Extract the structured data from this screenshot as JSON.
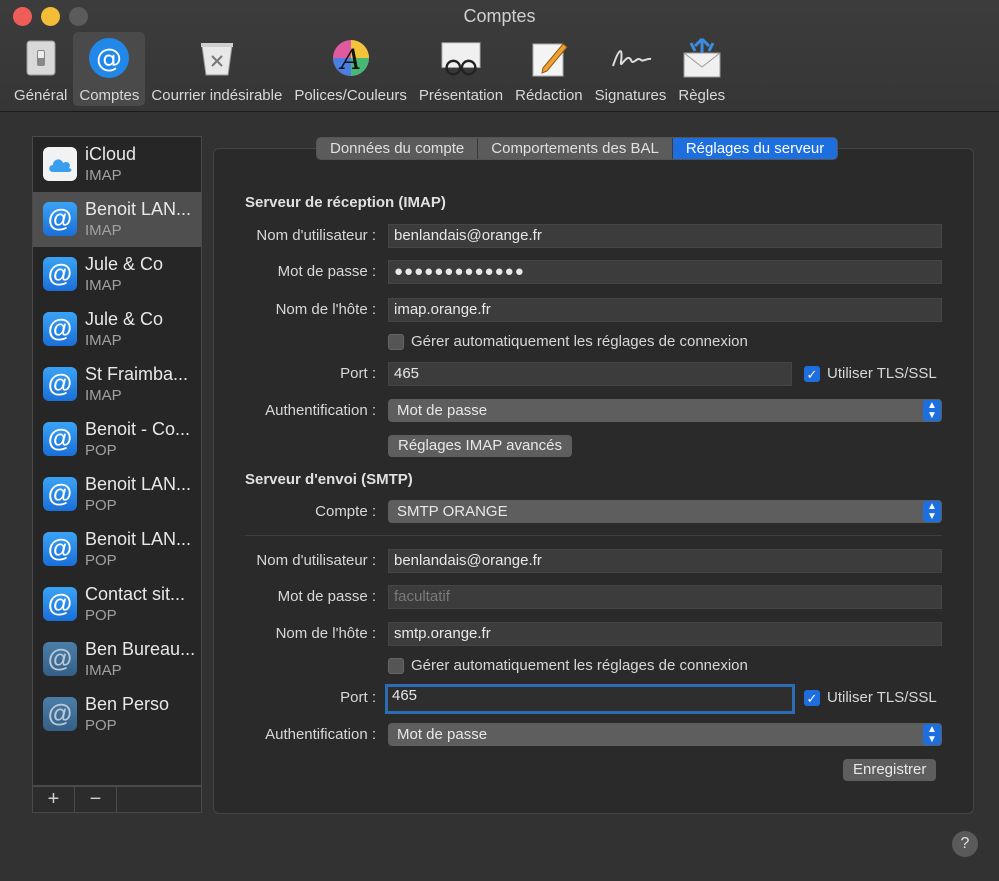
{
  "window": {
    "title": "Comptes"
  },
  "toolbar": {
    "items": [
      {
        "label": "Général",
        "icon": "general-switch-icon"
      },
      {
        "label": "Comptes",
        "icon": "at-sign-icon",
        "active": true
      },
      {
        "label": "Courrier indésirable",
        "icon": "junk-trash-icon"
      },
      {
        "label": "Polices/Couleurs",
        "icon": "fonts-colors-icon"
      },
      {
        "label": "Présentation",
        "icon": "viewing-glasses-icon"
      },
      {
        "label": "Rédaction",
        "icon": "composing-pencil-icon"
      },
      {
        "label": "Signatures",
        "icon": "signature-icon"
      },
      {
        "label": "Règles",
        "icon": "rules-envelope-icon"
      }
    ]
  },
  "accounts": [
    {
      "name": "iCloud",
      "type": "IMAP",
      "icon": "icloud-icon"
    },
    {
      "name": "Benoit LAN...",
      "type": "IMAP",
      "icon": "at-sign-icon",
      "selected": true
    },
    {
      "name": "Jule & Co",
      "type": "IMAP",
      "icon": "at-sign-icon"
    },
    {
      "name": "Jule & Co",
      "type": "IMAP",
      "icon": "at-sign-icon"
    },
    {
      "name": "St Fraimba...",
      "type": "IMAP",
      "icon": "at-sign-icon"
    },
    {
      "name": "Benoit - Co...",
      "type": "POP",
      "icon": "at-sign-icon"
    },
    {
      "name": "Benoit LAN...",
      "type": "POP",
      "icon": "at-sign-icon"
    },
    {
      "name": "Benoit LAN...",
      "type": "POP",
      "icon": "at-sign-icon"
    },
    {
      "name": "Contact sit...",
      "type": "POP",
      "icon": "at-sign-icon"
    },
    {
      "name": "Ben Bureau...",
      "type": "IMAP",
      "icon": "at-sign-icon",
      "dim": true
    },
    {
      "name": "Ben Perso",
      "type": "POP",
      "icon": "at-sign-icon",
      "dim": true
    }
  ],
  "list_footer": {
    "add": "+",
    "remove": "−"
  },
  "tabs": [
    {
      "label": "Données du compte"
    },
    {
      "label": "Comportements des BAL"
    },
    {
      "label": "Réglages du serveur",
      "active": true
    }
  ],
  "incoming": {
    "title": "Serveur de réception (IMAP)",
    "username_label": "Nom d'utilisateur :",
    "username": "benlandais@orange.fr",
    "password_label": "Mot de passe :",
    "password": "●●●●●●●●●●●●●",
    "host_label": "Nom de l'hôte :",
    "host": "imap.orange.fr",
    "auto_manage": "Gérer automatiquement les réglages de connexion",
    "port_label": "Port :",
    "port": "465",
    "tls_label": "Utiliser TLS/SSL",
    "auth_label": "Authentification :",
    "auth": "Mot de passe",
    "advanced_button": "Réglages IMAP avancés"
  },
  "outgoing": {
    "title": "Serveur d'envoi (SMTP)",
    "account_label": "Compte :",
    "account": "SMTP ORANGE",
    "username_label": "Nom d'utilisateur :",
    "username": "benlandais@orange.fr",
    "password_label": "Mot de passe :",
    "password_placeholder": "facultatif",
    "host_label": "Nom de l'hôte :",
    "host": "smtp.orange.fr",
    "auto_manage": "Gérer automatiquement les réglages de connexion",
    "port_label": "Port :",
    "port": "465",
    "tls_label": "Utiliser TLS/SSL",
    "auth_label": "Authentification :",
    "auth": "Mot de passe"
  },
  "save_button": "Enregistrer",
  "help": "?"
}
